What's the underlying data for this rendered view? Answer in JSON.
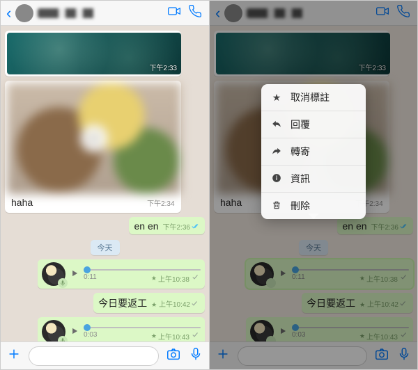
{
  "colors": {
    "ios_blue": "#007aff",
    "out_bubble": "#dcf8c6"
  },
  "header": {
    "contact_blurred": true,
    "video_icon": "video-icon",
    "call_icon": "phone-icon"
  },
  "messages": {
    "wallpaper_time": "下午2:33",
    "food_caption": "haha",
    "food_time": "下午2:34",
    "reply_text": "en en",
    "reply_time": "下午2:36",
    "date_chip": "今天",
    "voice1_duration": "0:11",
    "voice1_time": "上午10:38",
    "text_out": "今日要返工",
    "text_out_time": "上午10:42",
    "voice2_duration": "0:03",
    "voice2_time": "上午10:43",
    "starred_prefix": "★"
  },
  "context_menu": {
    "items": [
      {
        "icon": "star",
        "label": "取消標註"
      },
      {
        "icon": "reply",
        "label": "回覆"
      },
      {
        "icon": "fwd",
        "label": "轉寄"
      },
      {
        "icon": "info",
        "label": "資訊"
      },
      {
        "icon": "trash",
        "label": "刪除"
      }
    ]
  },
  "footer": {
    "attach_icon": "plus-icon",
    "camera_icon": "camera-icon",
    "mic_icon": "mic-icon"
  }
}
